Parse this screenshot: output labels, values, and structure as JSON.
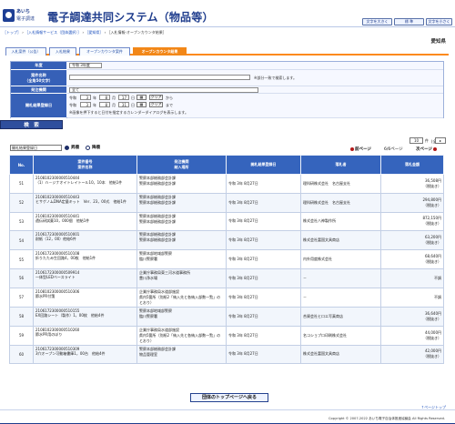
{
  "header": {
    "logo_line1": "あいち",
    "logo_line2": "電子調達",
    "title": "電子調達共同システム（物品等）",
    "font_large": "文字を大きく",
    "standard": "標 準",
    "font_small": "文字を小さく"
  },
  "breadcrumb": {
    "top": "［トップ］",
    "info": "［入札情報サービス（団体選択）］",
    "menu": "［愛知県］",
    "current": "［入札情報-オープンカウンタ結果］"
  },
  "region": "愛知県",
  "tabs": [
    "入札案件（公告）",
    "入札結果",
    "オープンカウンタ案件",
    "オープンカウンタ結果"
  ],
  "filter": {
    "fiscal_year_label": "年度",
    "fiscal_year_value": "令和 3年度",
    "case_name_label": "案件名称",
    "case_name_sublabel": "（全角50文字）",
    "case_note": "※部分一致で検索します。",
    "order_org_label": "発注機関",
    "order_org_value": "全て",
    "date_label": "開札結果登録日",
    "era": "令和",
    "from_year": "3",
    "from_month": "8",
    "from_day": "17",
    "to_year": "3",
    "to_month": "8",
    "to_day": "31",
    "year_unit": "年",
    "month_unit": "月",
    "day_unit": "日",
    "calendar": "カレンダー",
    "clear": "クリア",
    "from_text": "から",
    "to_text": "まで",
    "calendar_note": "※画像を押下すると日付を指定するカレンダーダイアログを表示します。"
  },
  "search_button": "検　索",
  "sort": {
    "value": "開札結果登録日",
    "asc": "昇順",
    "desc": "降順"
  },
  "pagination": {
    "page_size_label": "(全61件)",
    "page_size": "10",
    "unit": "件",
    "prev": "前ページ",
    "page": "6/6ページ",
    "next": "次ページ"
  },
  "table": {
    "headers": [
      "No.",
      "案件番号\n案件名称",
      "発注機関\n納入場所",
      "開札結果登録日",
      "落札者",
      "落札金額"
    ],
    "rows": [
      {
        "no": "51",
        "number": "2108102300000510444",
        "name": "（1）ｎ－ジナオイトレイトール10，10本　他給1件",
        "org": "警察本部総務部会計課",
        "place": "警察本部総務部会計課",
        "date": "令和 3年 8月27日",
        "winner": "理科研株式会社　名古屋支社",
        "amount": "36,508円",
        "tax": "（税抜き）"
      },
      {
        "no": "52",
        "number": "2108102300000510443",
        "name": "ヒサゲノムDNA定量キット　Ver．23，00式　他給1件",
        "org": "警察本部総務部会計課",
        "place": "警察本部総務部会計課",
        "date": "令和 3年 8月27日",
        "winner": "理科研株式会社　名古屋支社",
        "amount": "294,800円",
        "tax": "（税抜き）"
      },
      {
        "no": "53",
        "number": "2108102300000510441",
        "name": "遺伝研試薬10，000個　他給1件",
        "org": "警察本部総務部会計課",
        "place": "警察本部総務部会計課",
        "date": "令和 3年 8月27日",
        "winner": "株式会社八神製作所",
        "amount": "872,150円",
        "tax": "（税抜き）"
      },
      {
        "no": "54",
        "number": "2106172300000510001",
        "name": "耐紙（12，00）他給6件",
        "org": "警察本部総務部会計課",
        "place": "警察本部総務部会計課",
        "date": "令和 3年 8月27日",
        "winner": "株式会社富国文具商店",
        "amount": "63,200円",
        "tax": "（税抜き）"
      },
      {
        "no": "55",
        "number": "2106172300000510108",
        "name": "折りたたみ生回路4，00枚　他給1件",
        "org": "警察本部地域部警察",
        "place": "臨川警察署",
        "date": "令和 3年 8月27日",
        "winner": "内外用度株式会社",
        "amount": "68,640円",
        "tax": "（税抜き）"
      },
      {
        "no": "56",
        "number": "2106172300000509914",
        "name": "一体型LEDベースライト",
        "org": "企業庁事務局東三河水道事務所",
        "place": "豊川浄水場",
        "date": "令和 3年 8月27日",
        "winner": "－",
        "amount": "不調",
        "tax": ""
      },
      {
        "no": "57",
        "number": "2108102300000510306",
        "name": "節水PR付箋",
        "org": "企業庁事務局水道部施設",
        "place": "県内5箇所（別紙2「納入先と各納入部数一覧」のとおり）",
        "date": "令和 3年 8月27日",
        "winner": "－",
        "amount": "不調",
        "tax": ""
      },
      {
        "no": "58",
        "number": "2106172300000510155",
        "name": "EX回路シート（製作）1，00枚　他給4件",
        "org": "警察本部地域部警察",
        "place": "臨川警察署",
        "date": "令和 3年 8月27日",
        "winner": "合資会社ヒロエ写真商店",
        "amount": "36,640円",
        "tax": "（税抜き）"
      },
      {
        "no": "59",
        "number": "2108102300000510260",
        "name": "節水PR用のぼり",
        "org": "企業庁事務局水道部施設",
        "place": "県内5箇所（別紙2「納入先と各納入部数一覧」のとおり）",
        "date": "令和 3年 8月27日",
        "winner": "名コショプロ印刷株式会社",
        "amount": "44,000円",
        "tax": "（税抜き）"
      },
      {
        "no": "60",
        "number": "2106172300000510309",
        "name": "3穴オープン可動箱書庫1，00台　他給4件",
        "org": "警察本部総務部会計課",
        "place": "物品管理室",
        "date": "令和 3年 8月27日",
        "winner": "株式会社富国文具商店",
        "amount": "42,000円",
        "tax": "（税抜き）"
      }
    ]
  },
  "top_button": "団体のトップページへ戻る",
  "page_top": "↑ページトップ",
  "copyright": "Copyright © 2007-2022 あいち電子自治体推進協議会 All Rights Reserved."
}
